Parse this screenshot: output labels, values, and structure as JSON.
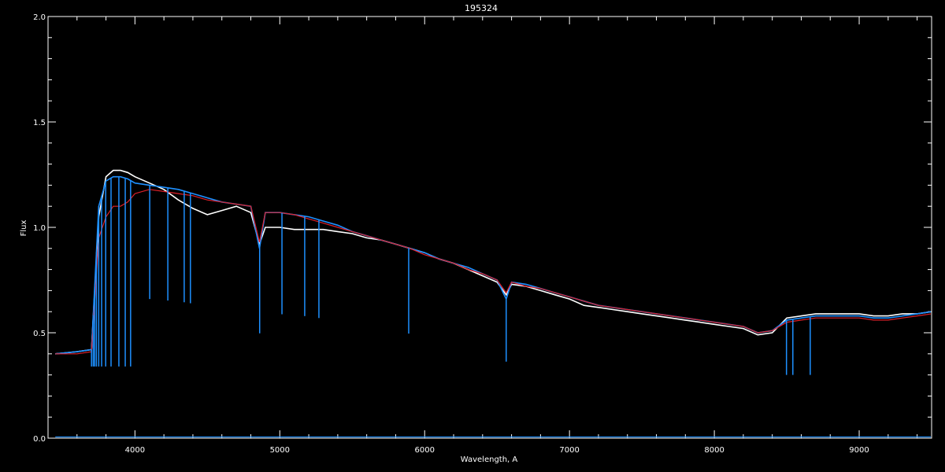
{
  "chart_data": {
    "type": "line",
    "title": "195324",
    "xlabel": "Wavelength, A",
    "ylabel": "Flux",
    "xlim": [
      3400,
      9500
    ],
    "ylim": [
      0.0,
      2.0
    ],
    "x_ticks": [
      4000,
      5000,
      6000,
      7000,
      8000,
      9000
    ],
    "x_tick_labels": [
      "4000",
      "5000",
      "6000",
      "7000",
      "8000",
      "9000"
    ],
    "y_ticks": [
      0.0,
      0.5,
      1.0,
      1.5,
      2.0
    ],
    "y_tick_labels": [
      "0.0",
      "0.5",
      "1.0",
      "1.5",
      "2.0"
    ],
    "grid": false,
    "background": "#000000",
    "series": [
      {
        "color": "#ffffff",
        "x": [
          3450,
          3600,
          3700,
          3750,
          3800,
          3850,
          3900,
          3950,
          4000,
          4100,
          4200,
          4300,
          4400,
          4500,
          4600,
          4700,
          4800,
          4860,
          4900,
          5000,
          5100,
          5200,
          5300,
          5400,
          5500,
          5600,
          5700,
          5800,
          5900,
          6000,
          6100,
          6200,
          6300,
          6400,
          6500,
          6563,
          6600,
          6700,
          6800,
          6900,
          7000,
          7100,
          7200,
          7300,
          7400,
          7500,
          7600,
          7700,
          7800,
          7900,
          8000,
          8100,
          8200,
          8300,
          8400,
          8500,
          8600,
          8700,
          8800,
          8900,
          9000,
          9100,
          9200,
          9300,
          9400,
          9500
        ],
        "y": [
          0.4,
          0.41,
          0.42,
          1.05,
          1.24,
          1.27,
          1.27,
          1.26,
          1.24,
          1.21,
          1.18,
          1.13,
          1.09,
          1.06,
          1.08,
          1.1,
          1.07,
          0.92,
          1.0,
          1.0,
          0.99,
          0.99,
          0.99,
          0.98,
          0.97,
          0.95,
          0.94,
          0.92,
          0.9,
          0.88,
          0.85,
          0.83,
          0.8,
          0.77,
          0.74,
          0.68,
          0.73,
          0.72,
          0.7,
          0.68,
          0.66,
          0.63,
          0.62,
          0.61,
          0.6,
          0.59,
          0.58,
          0.57,
          0.56,
          0.55,
          0.54,
          0.53,
          0.52,
          0.49,
          0.5,
          0.57,
          0.58,
          0.59,
          0.59,
          0.59,
          0.59,
          0.58,
          0.58,
          0.59,
          0.59,
          0.6
        ]
      },
      {
        "color": "#1e90ff",
        "x": [
          3450,
          3600,
          3700,
          3750,
          3800,
          3850,
          3900,
          3950,
          4000,
          4100,
          4200,
          4300,
          4400,
          4500,
          4600,
          4700,
          4800,
          4860,
          4900,
          5000,
          5100,
          5200,
          5300,
          5400,
          5500,
          5600,
          5700,
          5800,
          5900,
          6000,
          6100,
          6200,
          6300,
          6400,
          6500,
          6563,
          6600,
          6700,
          6800,
          6900,
          7000,
          7100,
          7200,
          7300,
          7400,
          7500,
          7600,
          7700,
          7800,
          7900,
          8000,
          8100,
          8200,
          8300,
          8400,
          8500,
          8600,
          8700,
          8800,
          8900,
          9000,
          9100,
          9200,
          9300,
          9400,
          9500
        ],
        "y": [
          0.4,
          0.41,
          0.42,
          1.1,
          1.22,
          1.24,
          1.24,
          1.23,
          1.21,
          1.2,
          1.19,
          1.18,
          1.16,
          1.14,
          1.12,
          1.11,
          1.1,
          0.9,
          1.07,
          1.07,
          1.06,
          1.05,
          1.03,
          1.01,
          0.98,
          0.96,
          0.94,
          0.92,
          0.9,
          0.88,
          0.85,
          0.83,
          0.81,
          0.78,
          0.75,
          0.66,
          0.74,
          0.73,
          0.71,
          0.69,
          0.67,
          0.65,
          0.63,
          0.62,
          0.61,
          0.6,
          0.59,
          0.58,
          0.57,
          0.56,
          0.55,
          0.54,
          0.53,
          0.5,
          0.51,
          0.56,
          0.57,
          0.58,
          0.58,
          0.58,
          0.58,
          0.57,
          0.57,
          0.58,
          0.59,
          0.6
        ]
      },
      {
        "color": "#e0202a",
        "x": [
          3450,
          3600,
          3700,
          3750,
          3800,
          3850,
          3900,
          3950,
          4000,
          4100,
          4200,
          4300,
          4400,
          4500,
          4600,
          4700,
          4800,
          4860,
          4900,
          5000,
          5100,
          5200,
          5300,
          5400,
          5500,
          5600,
          5700,
          5800,
          5900,
          6000,
          6100,
          6200,
          6300,
          6400,
          6500,
          6563,
          6600,
          6700,
          6800,
          6900,
          7000,
          7100,
          7200,
          7300,
          7400,
          7500,
          7600,
          7700,
          7800,
          7900,
          8000,
          8100,
          8200,
          8300,
          8400,
          8500,
          8600,
          8700,
          8800,
          8900,
          9000,
          9100,
          9200,
          9300,
          9400,
          9500
        ],
        "y": [
          0.4,
          0.4,
          0.41,
          0.95,
          1.05,
          1.1,
          1.1,
          1.12,
          1.16,
          1.18,
          1.17,
          1.16,
          1.15,
          1.13,
          1.12,
          1.11,
          1.1,
          0.93,
          1.07,
          1.07,
          1.06,
          1.04,
          1.02,
          1.0,
          0.98,
          0.96,
          0.94,
          0.92,
          0.9,
          0.87,
          0.85,
          0.83,
          0.8,
          0.78,
          0.75,
          0.69,
          0.74,
          0.72,
          0.71,
          0.69,
          0.67,
          0.65,
          0.63,
          0.62,
          0.61,
          0.6,
          0.59,
          0.58,
          0.57,
          0.56,
          0.55,
          0.54,
          0.53,
          0.5,
          0.51,
          0.55,
          0.56,
          0.57,
          0.57,
          0.57,
          0.57,
          0.56,
          0.56,
          0.57,
          0.58,
          0.59
        ]
      },
      {
        "color": "#1e90ff",
        "x": [
          3450,
          9500
        ],
        "y": [
          0.005,
          0.005
        ]
      }
    ],
    "absorption_lines": [
      3700,
      3712,
      3722,
      3734,
      3750,
      3770,
      3798,
      3835,
      3889,
      3933,
      3970,
      4102,
      4227,
      4340,
      4383,
      4861,
      5015,
      5172,
      5270,
      5890,
      6563,
      8498,
      8542,
      8662
    ]
  }
}
